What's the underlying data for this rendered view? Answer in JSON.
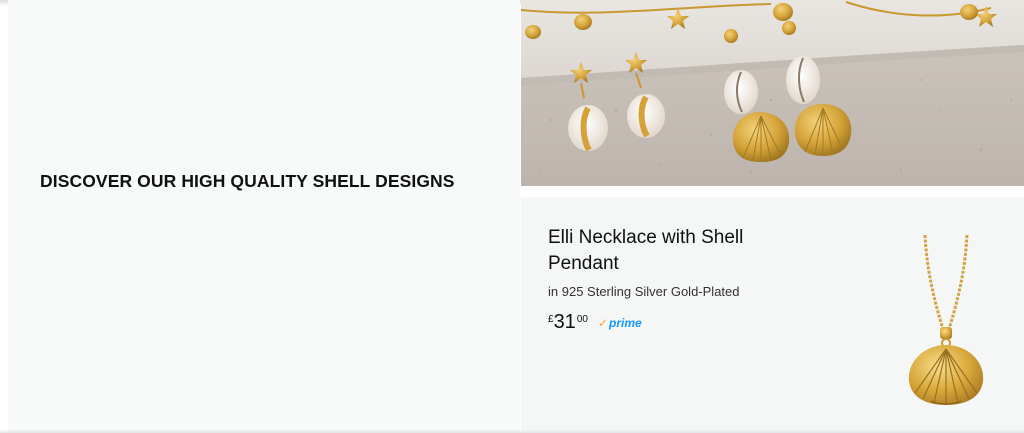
{
  "promo": {
    "headline": "DISCOVER OUR HIGH QUALITY SHELL DESIGNS"
  },
  "hero_image": {
    "subject": "gold shell earrings and starfish necklaces on sand"
  },
  "product": {
    "title": "Elli Necklace with Shell Pendant",
    "subtitle": "in 925 Sterling Silver Gold-Plated",
    "price": {
      "currency_symbol": "£",
      "whole": "31",
      "fraction": "00"
    },
    "badge_label": "prime",
    "badge_check": "✓",
    "image_subject": "gold shell pendant necklace"
  },
  "colors": {
    "text_primary": "#0f1111",
    "prime_blue": "#1399ff",
    "prime_check_orange": "#f7a33c",
    "panel_bg": "#f8f9f9",
    "sand": "#d8d1c9",
    "gold": "#d4a237"
  }
}
